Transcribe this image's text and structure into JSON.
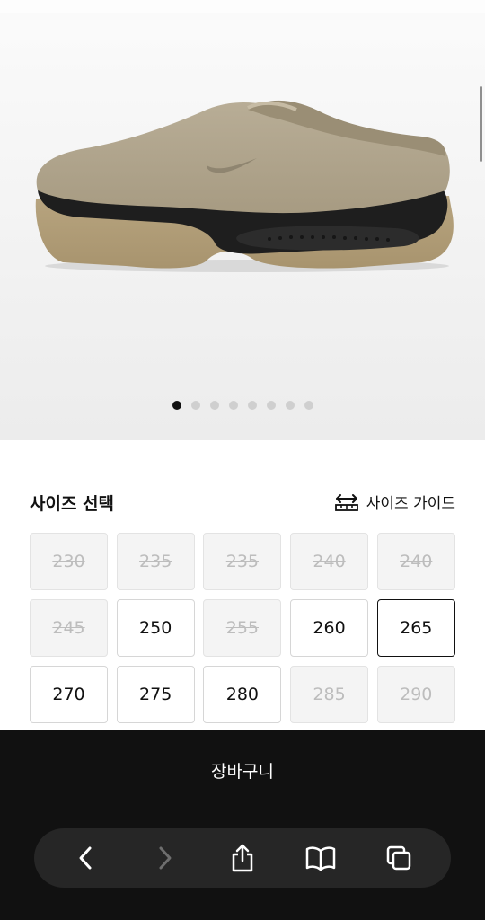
{
  "gallery": {
    "image_alt": "Nike suede mule",
    "dots": [
      true,
      false,
      false,
      false,
      false,
      false,
      false,
      false
    ]
  },
  "size_section": {
    "title": "사이즈 선택",
    "guide_label": "사이즈 가이드",
    "sizes": [
      {
        "label": "230",
        "available": false,
        "selected": false
      },
      {
        "label": "235",
        "available": false,
        "selected": false
      },
      {
        "label": "235",
        "available": false,
        "selected": false
      },
      {
        "label": "240",
        "available": false,
        "selected": false
      },
      {
        "label": "240",
        "available": false,
        "selected": false
      },
      {
        "label": "245",
        "available": false,
        "selected": false
      },
      {
        "label": "250",
        "available": true,
        "selected": false
      },
      {
        "label": "255",
        "available": false,
        "selected": false
      },
      {
        "label": "260",
        "available": true,
        "selected": false
      },
      {
        "label": "265",
        "available": true,
        "selected": true
      },
      {
        "label": "270",
        "available": true,
        "selected": false
      },
      {
        "label": "275",
        "available": true,
        "selected": false
      },
      {
        "label": "280",
        "available": true,
        "selected": false
      },
      {
        "label": "285",
        "available": false,
        "selected": false
      },
      {
        "label": "290",
        "available": false,
        "selected": false
      }
    ]
  },
  "cart": {
    "label": "장바구니"
  },
  "browser_toolbar": {
    "buttons": [
      "back-icon",
      "forward-icon",
      "share-icon",
      "bookmarks-icon",
      "tabs-icon"
    ]
  }
}
